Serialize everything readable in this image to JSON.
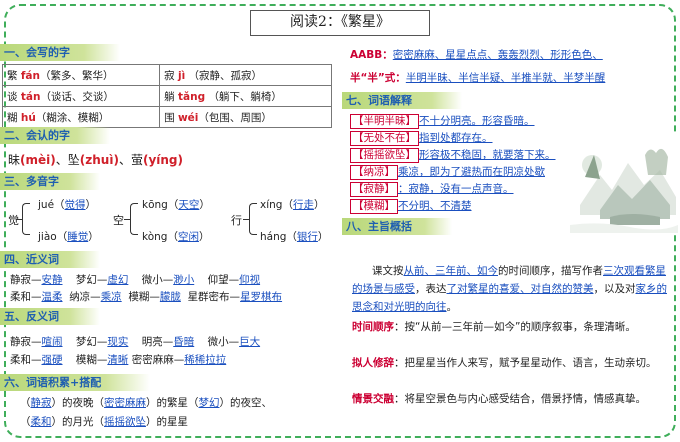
{
  "title": "阅读2：《繁星》",
  "s1": {
    "heading": "一、会写的字",
    "rows": [
      [
        {
          "ch": "繁",
          "py": "fán",
          "ex": "（繁多、繁华）"
        },
        {
          "ch": "寂",
          "py": "jì",
          "ex": "（寂静、孤寂）"
        }
      ],
      [
        {
          "ch": "谈",
          "py": "tán",
          "ex": "（谈话、交谈）"
        },
        {
          "ch": "躺",
          "py": "tǎng",
          "ex": "（躺下、躺椅）"
        }
      ],
      [
        {
          "ch": "糊",
          "py": "hú",
          "ex": "（糊涂、模糊）"
        },
        {
          "ch": "围",
          "py": "wéi",
          "ex": "（包围、周围）"
        }
      ]
    ]
  },
  "s2": {
    "heading": "二、会认的字",
    "c1": "昧",
    "p1": "(mèi)",
    "sep1": "、",
    "c2": "坠",
    "p2": "(zhuì)",
    "sep2": "、",
    "c3": "萤",
    "p3": "(yíng)"
  },
  "s3": {
    "heading": "三、多音字",
    "jue": {
      "ch": "觉",
      "r1": "jué（",
      "w1": "觉得",
      "e1": "）",
      "r2": "jiào（",
      "w2": "睡觉",
      "e2": "）"
    },
    "kong": {
      "ch": "空",
      "r1": "kōng（",
      "w1": "天空",
      "e1": "）",
      "r2": "kòng（",
      "w2": "空闲",
      "e2": "）"
    },
    "xing": {
      "ch": "行",
      "r1": "xíng（",
      "w1": "行走",
      "e1": "）",
      "r2": "háng（",
      "w2": "银行",
      "e2": "）"
    }
  },
  "s4": {
    "heading": "四、近义词",
    "line1": [
      {
        "a": "静寂—",
        "b": "安静"
      },
      {
        "a": "梦幻—",
        "b": "虚幻"
      },
      {
        "a": "微小—",
        "b": "渺小"
      },
      {
        "a": "仰望—",
        "b": "仰视"
      }
    ],
    "line2": [
      {
        "a": "柔和—",
        "b": "温柔"
      },
      {
        "a": "纳凉—",
        "b": "乘凉"
      },
      {
        "a": "模糊—",
        "b": "朦胧"
      },
      {
        "a": "星群密布—",
        "b": "星罗棋布"
      }
    ]
  },
  "s5": {
    "heading": "五、反义词",
    "line1": [
      {
        "a": "静寂—",
        "b": "喧闹"
      },
      {
        "a": "梦幻—",
        "b": "现实"
      },
      {
        "a": "明亮—",
        "b": "昏暗"
      },
      {
        "a": "微小—",
        "b": "巨大"
      }
    ],
    "line2": [
      {
        "a": "柔和—",
        "b": "强硬"
      },
      {
        "a": "模糊—",
        "b": "清晰"
      },
      {
        "a": "密密麻麻—",
        "b": "稀稀拉拉"
      }
    ]
  },
  "s6": {
    "heading": "六、词语积累+搭配",
    "l1": {
      "p1": "（",
      "w1": "静寂",
      "p2": "）的夜晚（",
      "w2": "密密麻麻",
      "p3": "）的繁星（",
      "w3": "梦幻",
      "p4": "）的夜空、"
    },
    "l2": {
      "p1": "（",
      "w1": "柔和",
      "p2": "）的月光（",
      "w2": "摇摇欲坠",
      "p3": "）的星星"
    }
  },
  "right": {
    "aabb_label": "AABB：",
    "aabb_items": "密密麻麻、星星点点、轰轰烈烈、形形色色、",
    "banban_label": "半“半”式：",
    "banban_items": "半明半昧、半信半疑、半推半就、半梦半醒",
    "s7_heading": "七、词语解释",
    "defs": [
      {
        "w": "【半明半昧】",
        "d": "不十分明亮。形容昏暗。"
      },
      {
        "w": "【无处不在】",
        "d": "指到处都存在。"
      },
      {
        "w": "【摇摇欲坠】",
        "d": "形容极不稳固，就要落下来。"
      },
      {
        "w": "【纳凉】",
        "d": "乘凉，即为了避热而在阴凉处歇"
      },
      {
        "w": "【寂静】",
        "d": "：寂静，没有一点声音。"
      },
      {
        "w": "【模糊】",
        "d": "不分明、不清楚"
      }
    ],
    "s8_heading": "八、主旨概括",
    "summary": {
      "a": "课文按",
      "b": "从前、三年前、如今",
      "c": "的时间顺序，描写作者",
      "d": "三次观看繁星的场景与感受",
      "e": "，表达",
      "f": "了对繁星的喜爱、对自然的赞美",
      "g": "，以及对",
      "h": "家乡的思念和对光明的向往",
      "i": "。"
    },
    "p1_label": "时间顺序",
    "p1_text": "：按“从前—三年前—如今”的顺序叙事，条理清晰。",
    "p2_label": "拟人修辞",
    "p2_text": "：把星星当作人来写，赋予星星动作、语言，生动亲切。",
    "p3_label": "情景交融",
    "p3_text": "：将星空景色与内心感受结合，借景抒情，情感真挚。"
  }
}
